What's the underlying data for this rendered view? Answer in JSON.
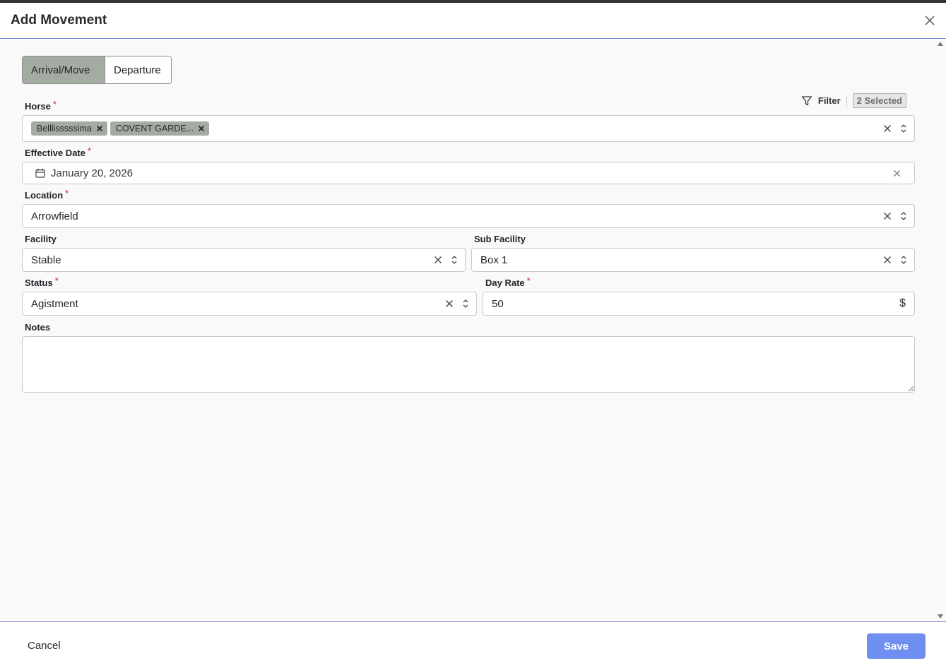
{
  "dialog": {
    "title": "Add Movement"
  },
  "tabs": {
    "arrival_label": "Arrival/Move",
    "departure_label": "Departure"
  },
  "horse": {
    "label": "Horse",
    "required": "*",
    "filter_label": "Filter",
    "selected_badge": "2 Selected",
    "chips": [
      {
        "label": "Belllisssssima"
      },
      {
        "label": "COVENT GARDE..."
      }
    ]
  },
  "effective_date": {
    "label": "Effective Date",
    "required": "*",
    "value": "January 20, 2026"
  },
  "location": {
    "label": "Location",
    "required": "*",
    "value": "Arrowfield"
  },
  "facility": {
    "label": "Facility",
    "value": "Stable"
  },
  "sub_facility": {
    "label": "Sub Facility",
    "value": "Box 1"
  },
  "status": {
    "label": "Status",
    "required": "*",
    "value": "Agistment"
  },
  "day_rate": {
    "label": "Day Rate",
    "required": "*",
    "value": "50",
    "currency": "$"
  },
  "notes": {
    "label": "Notes",
    "value": ""
  },
  "footer": {
    "cancel_label": "Cancel",
    "save_label": "Save"
  },
  "colors": {
    "accent": "#6f8ff0",
    "chip": "#a3aba2",
    "divider": "#7b86d6",
    "required": "#d21f1f"
  },
  "icons": [
    "close-icon",
    "filter-icon",
    "calendar-icon",
    "clear-icon",
    "up-down-icon"
  ]
}
